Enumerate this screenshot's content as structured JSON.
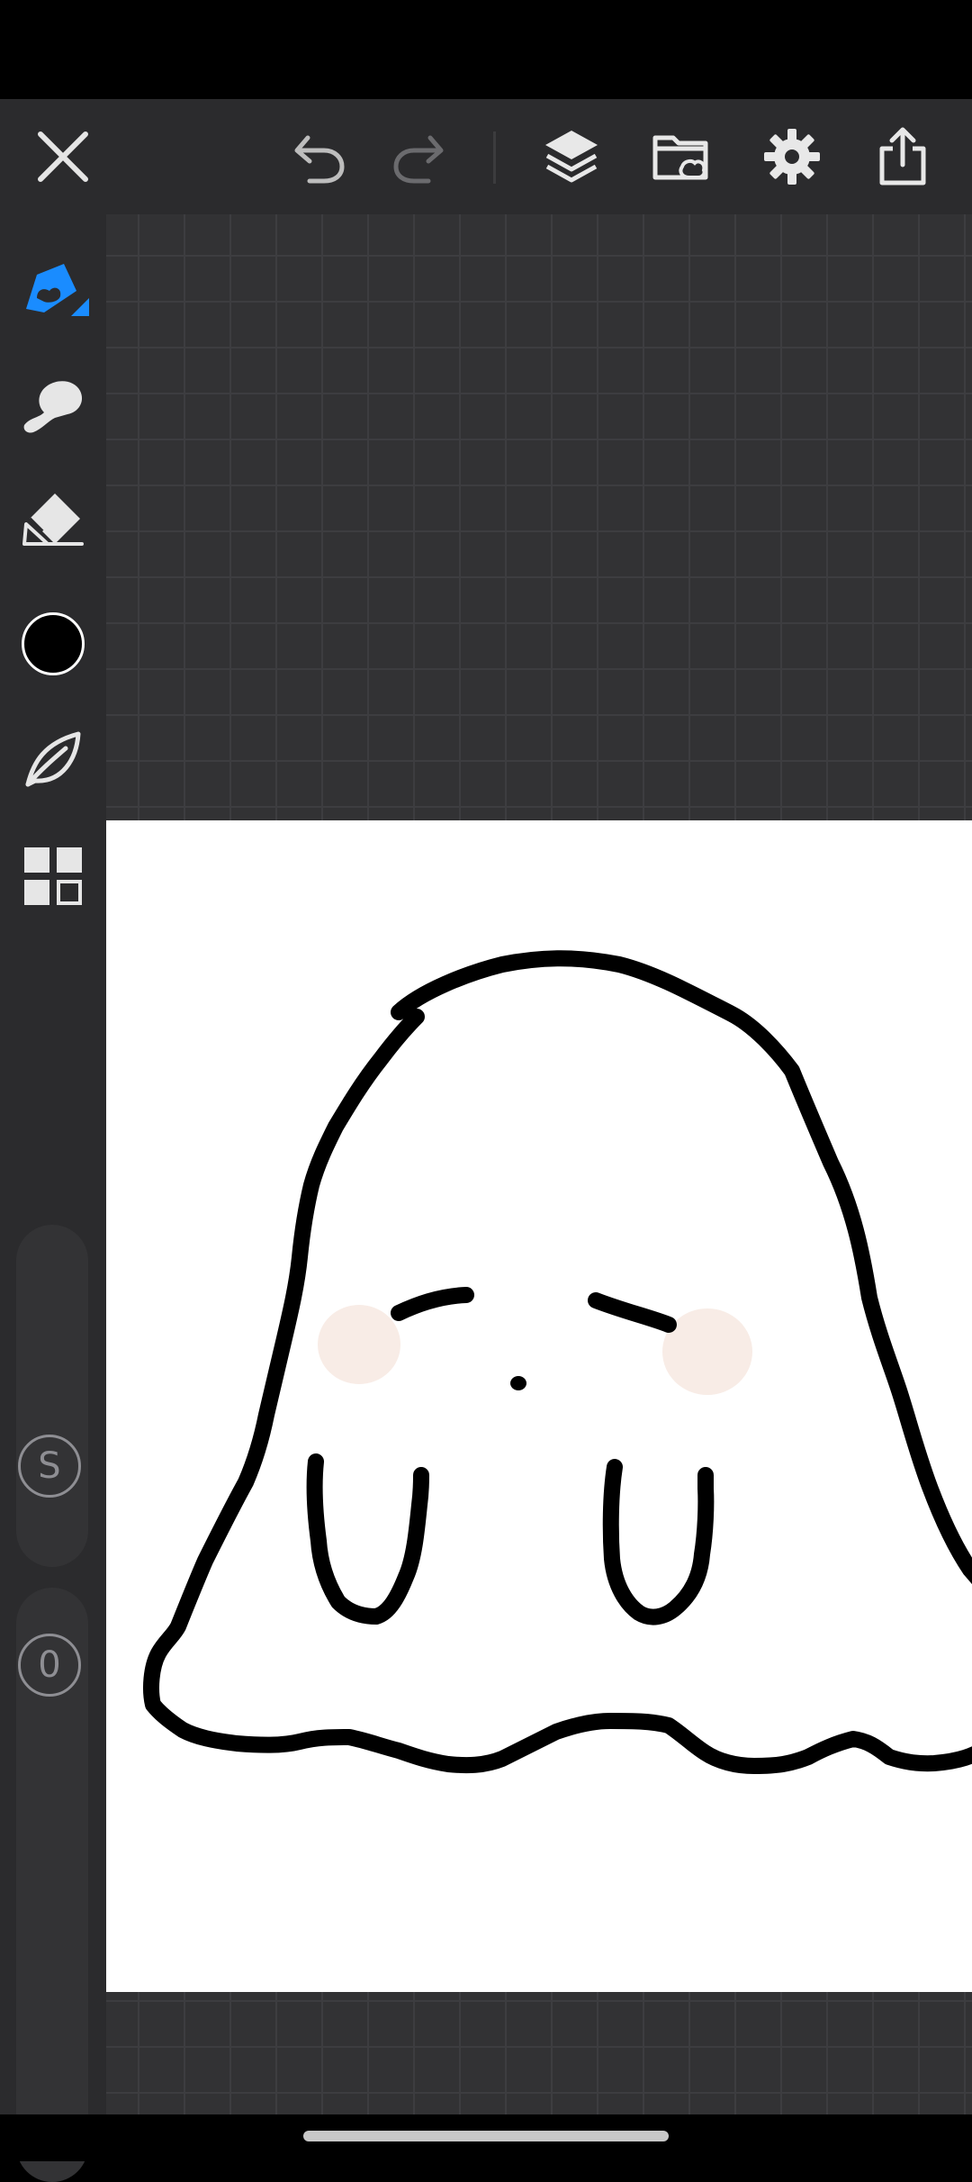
{
  "app": {
    "accent_color": "#1a8cff",
    "toolbar_bg": "#2b2b2d",
    "workspace_bg": "#323234"
  },
  "toolbar": {
    "buttons": [
      {
        "name": "close-icon",
        "kind": "close"
      },
      {
        "name": "undo-icon",
        "kind": "undo"
      },
      {
        "name": "redo-icon",
        "kind": "redo",
        "disabled": true
      },
      {
        "name": "layers-icon",
        "kind": "layers"
      },
      {
        "name": "gallery-folder-icon",
        "kind": "folder"
      },
      {
        "name": "settings-gear-icon",
        "kind": "gear"
      },
      {
        "name": "share-export-icon",
        "kind": "share"
      }
    ]
  },
  "sidebar": {
    "tools": [
      {
        "name": "pen-tool-icon",
        "selected": true
      },
      {
        "name": "smudge-finger-icon",
        "selected": false
      },
      {
        "name": "eraser-icon",
        "selected": false
      },
      {
        "name": "color-swatch",
        "color": "#000000"
      },
      {
        "name": "leaf-brush-icon",
        "selected": false
      },
      {
        "name": "tiles-grid-icon",
        "selected": false
      }
    ],
    "size_slider_label": "S",
    "opacity_slider_label": "0"
  },
  "canvas": {
    "background": "#ffffff",
    "stroke_color": "#000000",
    "blush_color": "#f8ece6"
  }
}
